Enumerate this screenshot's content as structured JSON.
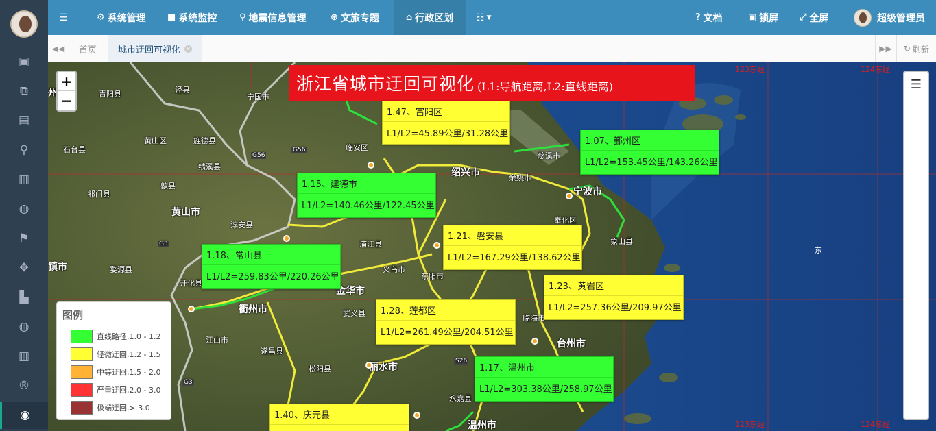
{
  "topbar": {
    "menu_items": [
      {
        "icon": "gear-icon",
        "label": "系统管理"
      },
      {
        "icon": "video-camera-icon",
        "label": "系统监控"
      },
      {
        "icon": "map-marker-icon",
        "label": "地震信息管理"
      },
      {
        "icon": "globe-icon",
        "label": "文旅专题"
      },
      {
        "icon": "bank-icon",
        "label": "行政区划"
      }
    ],
    "right_items": [
      {
        "icon": "question-circle-icon",
        "label": "文档"
      },
      {
        "icon": "lock-icon",
        "label": "锁屏"
      },
      {
        "icon": "expand-icon",
        "label": "全屏"
      }
    ],
    "user_name": "超级管理员"
  },
  "tabs": {
    "home_label": "首页",
    "active_label": "城市迂回可视化",
    "refresh_label": "刷新"
  },
  "map": {
    "title_main": "浙江省城市迂回可视化",
    "title_sub": "(L1:导航距离,L2:直线距离)",
    "east_label": "东",
    "labels": [
      {
        "id": "fuyang",
        "color": "yellow",
        "line1": "1.47、富阳区",
        "line2": "L1/L2=45.89公里/31.28公里"
      },
      {
        "id": "yinzhou",
        "color": "green",
        "line1": "1.07、鄞州区",
        "line2": "L1/L2=153.45公里/143.26公里"
      },
      {
        "id": "jiande",
        "color": "green",
        "line1": "1.15、建德市",
        "line2": "L1/L2=140.46公里/122.45公里"
      },
      {
        "id": "panan",
        "color": "yellow",
        "line1": "1.21、磐安县",
        "line2": "L1/L2=167.29公里/138.62公里"
      },
      {
        "id": "changshan",
        "color": "green",
        "line1": "1.18、常山县",
        "line2": "L1/L2=259.83公里/220.26公里"
      },
      {
        "id": "huangyan",
        "color": "yellow",
        "line1": "1.23、黄岩区",
        "line2": "L1/L2=257.36公里/209.97公里"
      },
      {
        "id": "liandu",
        "color": "yellow",
        "line1": "1.28、莲都区",
        "line2": "L1/L2=261.49公里/204.51公里"
      },
      {
        "id": "wenzhou",
        "color": "green",
        "line1": "1.17、温州市",
        "line2": "L1/L2=303.38公里/258.97公里"
      },
      {
        "id": "qingyuan",
        "color": "yellow",
        "line1": "1.40、庆元县",
        "line2": ""
      }
    ],
    "cities": [
      {
        "id": "hangzhou",
        "name": "州市"
      },
      {
        "id": "ningbo",
        "name": "宁波市"
      },
      {
        "id": "shaoxing",
        "name": "绍兴市"
      },
      {
        "id": "jinhua",
        "name": "金华市"
      },
      {
        "id": "quzhou",
        "name": "衢州市"
      },
      {
        "id": "lishui",
        "name": "丽水市"
      },
      {
        "id": "taizhou",
        "name": "台州市"
      },
      {
        "id": "huangshan",
        "name": "黄山市"
      },
      {
        "id": "wenzhou_c",
        "name": "温州市"
      },
      {
        "id": "qingyang",
        "name": "青阳县"
      },
      {
        "id": "jingxian",
        "name": "泾县"
      },
      {
        "id": "ningguo",
        "name": "宁国市"
      },
      {
        "id": "shitai",
        "name": "石台县"
      },
      {
        "id": "huangshanqu",
        "name": "黄山区"
      },
      {
        "id": "jingde",
        "name": "旌德县"
      },
      {
        "id": "jixi",
        "name": "绩溪县"
      },
      {
        "id": "qimen",
        "name": "祁门县"
      },
      {
        "id": "shexian",
        "name": "歙县"
      },
      {
        "id": "chunan",
        "name": "淳安县"
      },
      {
        "id": "pujiang",
        "name": "浦江县"
      },
      {
        "id": "yiwu",
        "name": "义乌市"
      },
      {
        "id": "wuyi",
        "name": "武义县"
      },
      {
        "id": "suichang",
        "name": "遂昌县"
      },
      {
        "id": "songyang",
        "name": "松阳县"
      },
      {
        "id": "jiangshan",
        "name": "江山市"
      },
      {
        "id": "kaihua",
        "name": "开化县"
      },
      {
        "id": "wuyuan",
        "name": "婺源县"
      },
      {
        "id": "linan",
        "name": "临安区"
      },
      {
        "id": "xiangshan",
        "name": "象山县"
      },
      {
        "id": "fenghua",
        "name": "奉化区"
      },
      {
        "id": "cixi",
        "name": "慈溪市"
      },
      {
        "id": "yuyao",
        "name": "余姚市"
      },
      {
        "id": "linhai",
        "name": "临海市"
      },
      {
        "id": "yongjia",
        "name": "永嘉县"
      },
      {
        "id": "zhenshi",
        "name": "镇市"
      },
      {
        "id": "dongyang",
        "name": "东阳市"
      }
    ],
    "grid_labels": [
      "123东经",
      "124东经",
      "123东经",
      "124东经"
    ],
    "road_labels": [
      "G56",
      "G56",
      "G3",
      "G3",
      "S26"
    ]
  },
  "legend": {
    "title": "图例",
    "items": [
      {
        "label": "直线路径,1.0 - 1.2",
        "color": "#33ff33"
      },
      {
        "label": "轻微迂回,1.2 - 1.5",
        "color": "#ffff33"
      },
      {
        "label": "中等迂回,1.5 - 2.0",
        "color": "#ffb233"
      },
      {
        "label": "严重迂回,2.0 - 3.0",
        "color": "#ff3333"
      },
      {
        "label": "极端迂回,> 3.0",
        "color": "#993333"
      }
    ]
  }
}
